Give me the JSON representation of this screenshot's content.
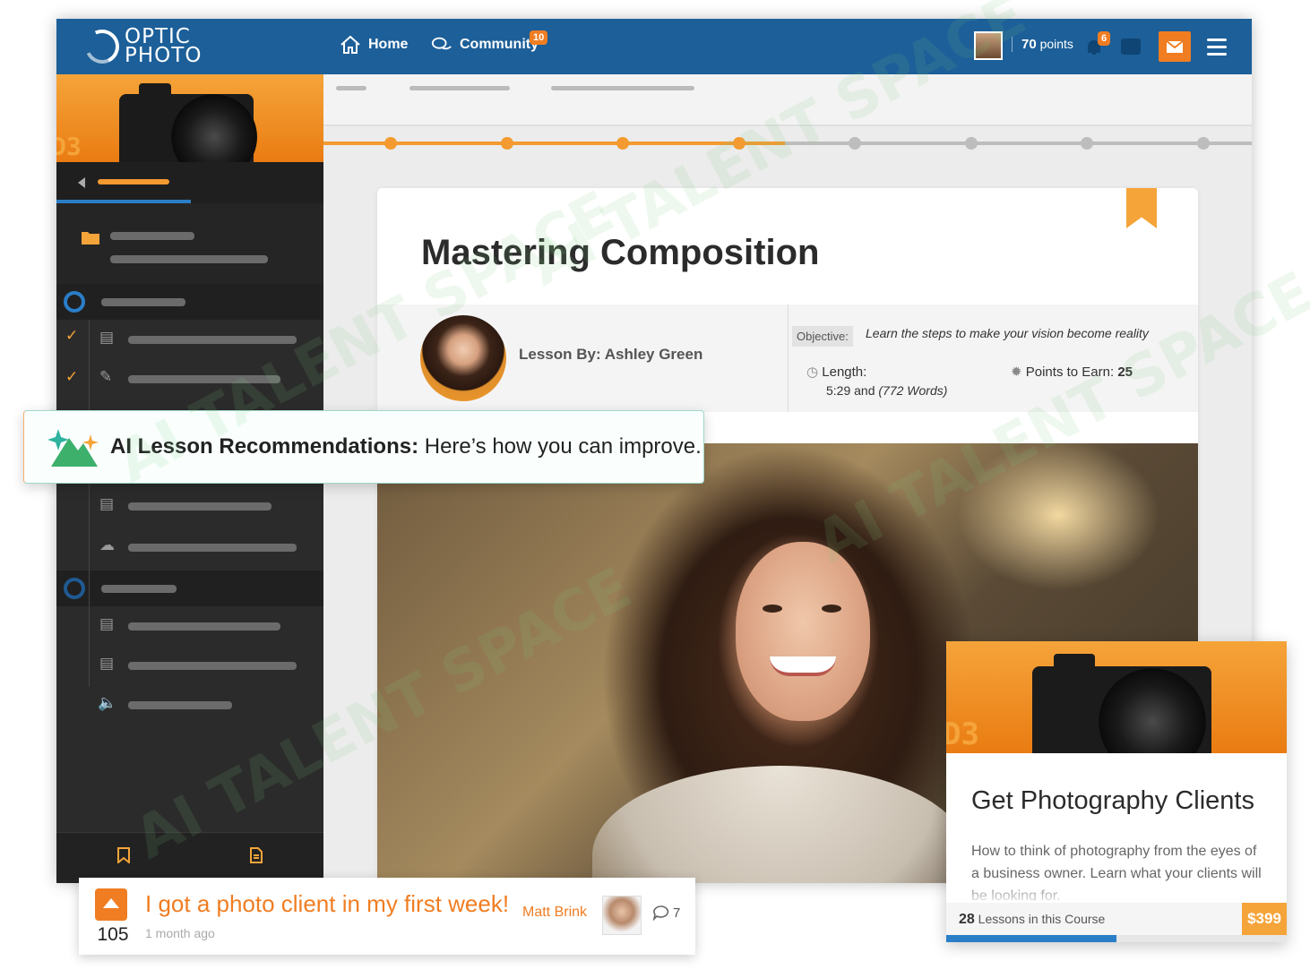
{
  "header": {
    "logo_line1": "OPTIC",
    "logo_line2": "PHOTO",
    "nav_home": "Home",
    "nav_community": "Community",
    "community_badge": "10",
    "points_value": "70",
    "points_label": "points",
    "notification_badge": "6",
    "colors": {
      "bar": "#1c5f99",
      "accent": "#f07d22"
    }
  },
  "sidebar": {
    "hero_text": "D3"
  },
  "lesson": {
    "title": "Mastering Composition",
    "author": "Lesson By: Ashley Green",
    "objective_label": "Objective:",
    "objective_text": "Learn the steps to make your vision become reality",
    "length_label": "Length:",
    "length_time": "5:29 and ",
    "length_words": "(772 Words)",
    "points_label": "Points to Earn: ",
    "points_value": "25"
  },
  "progress": {
    "completed_steps": 4,
    "total_steps": 8
  },
  "ai_banner": {
    "title": "AI Lesson Recommendations:",
    "text": " Here’s how you can improve."
  },
  "course_card": {
    "hero_text": "D3",
    "title": "Get Photography Clients",
    "description": "How to think of photography from the eyes of a business owner. Learn what your clients will be looking for.",
    "lesson_count": "28",
    "lesson_label": " Lessons in this Course",
    "price": "$399",
    "progress_fraction": 0.5
  },
  "post": {
    "votes": "105",
    "title": "I got a photo client in my first week!",
    "time": "1 month ago",
    "author": "Matt Brink",
    "comments": "7"
  }
}
